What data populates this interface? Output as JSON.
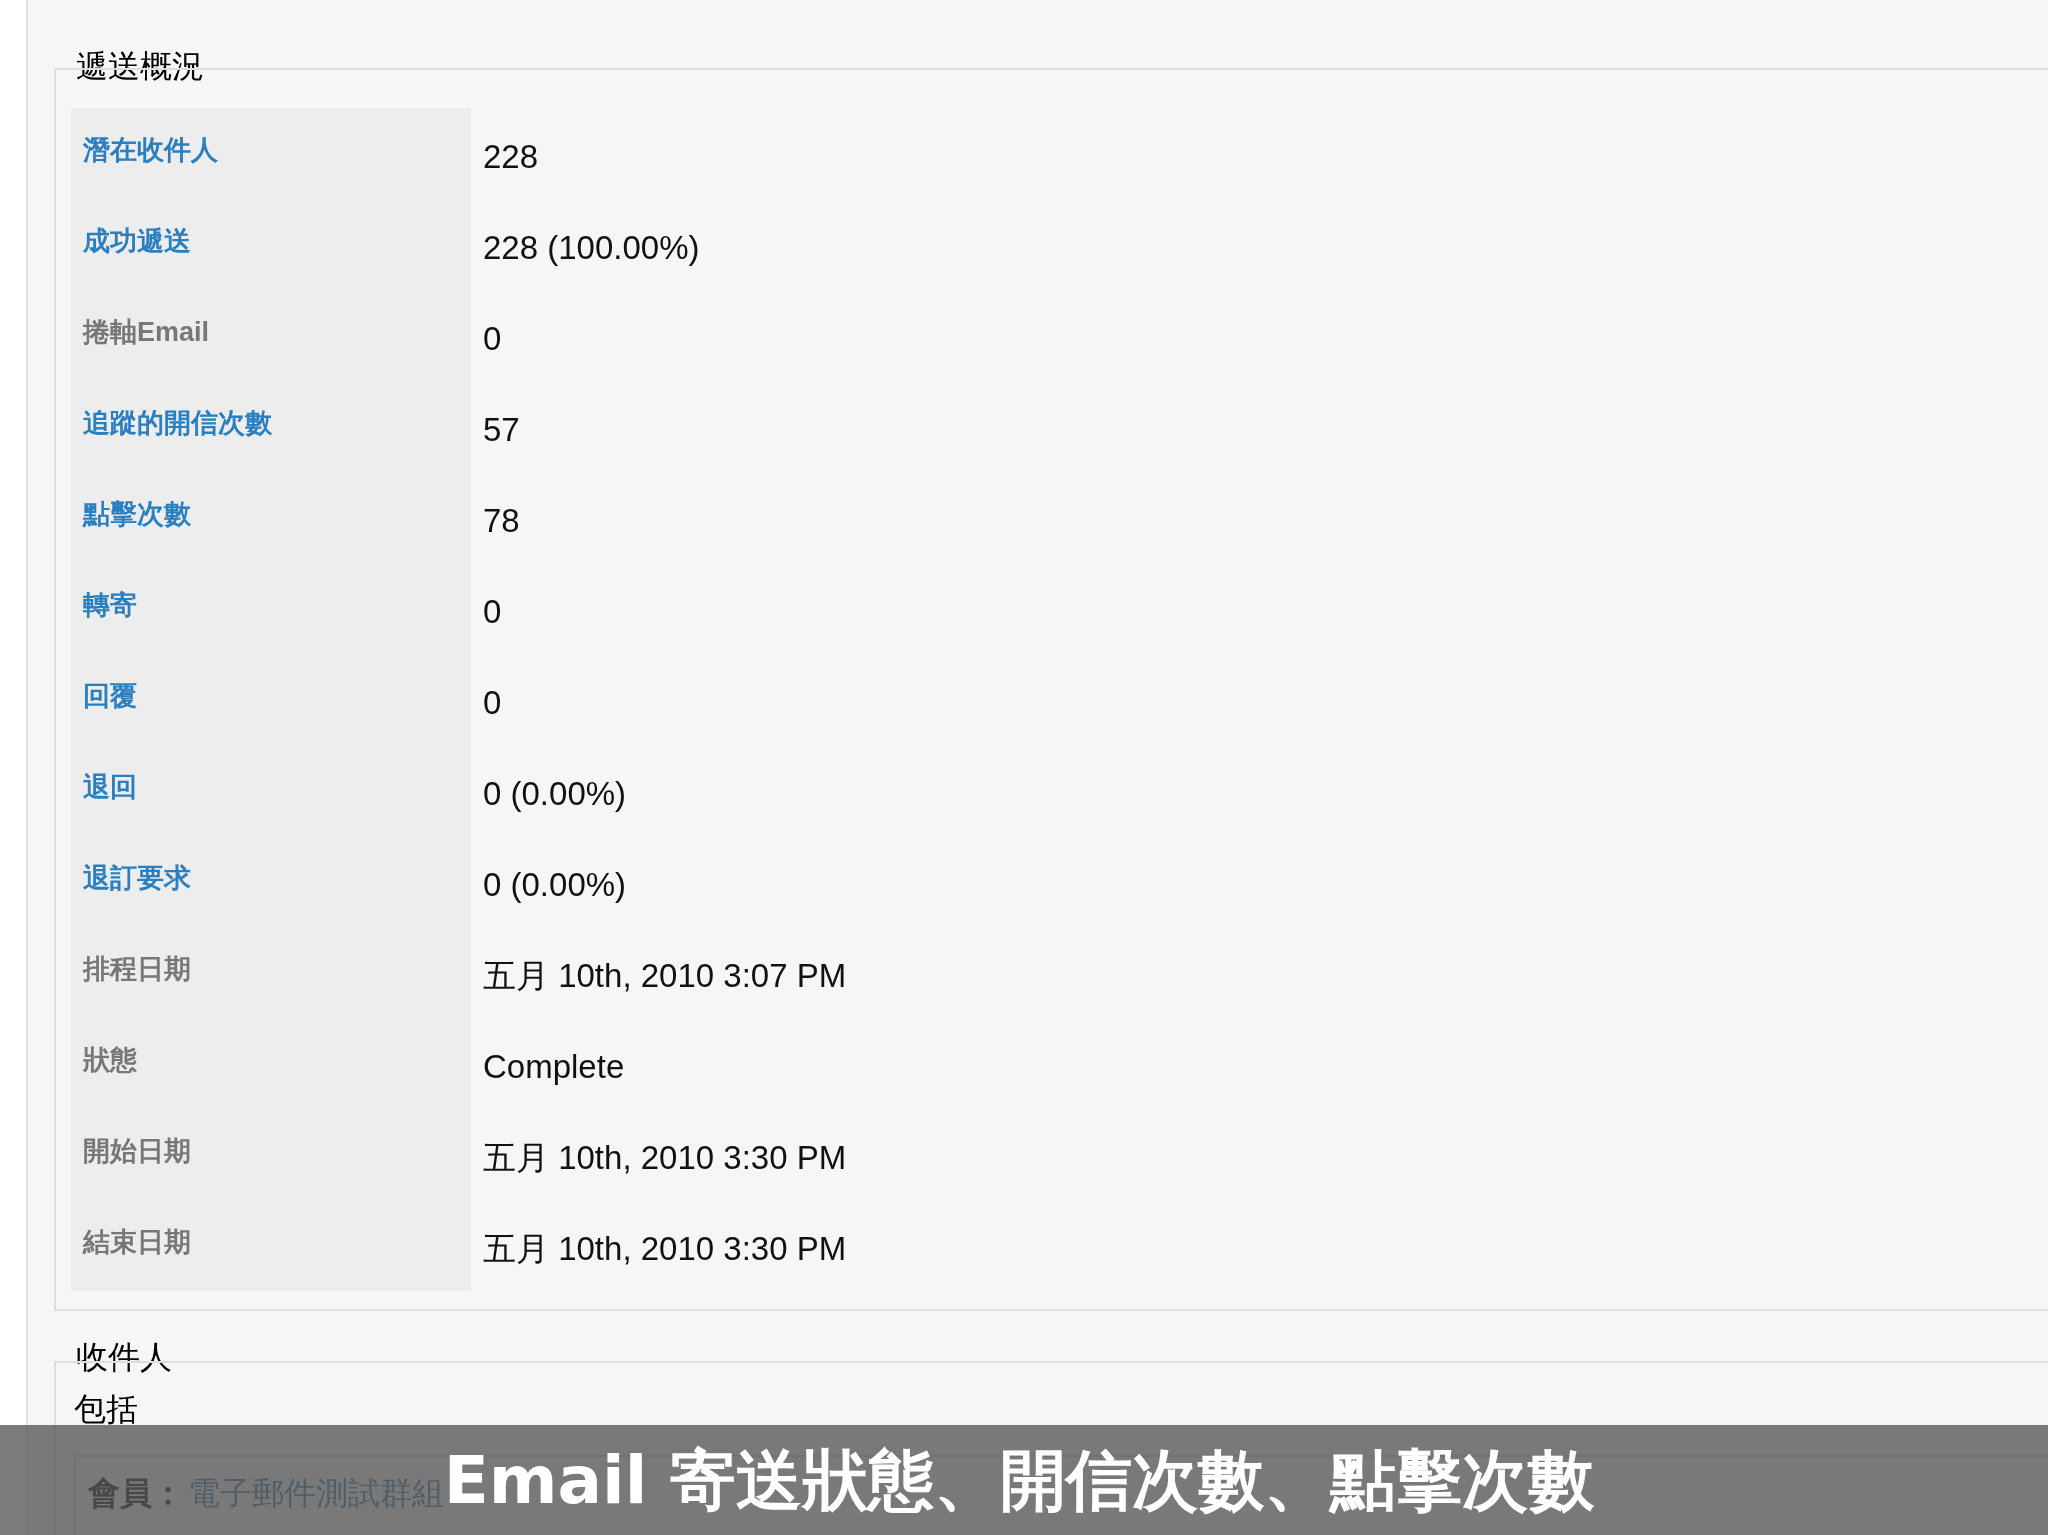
{
  "delivery_summary": {
    "title": "遞送概況",
    "rows": [
      {
        "label": "潛在收件人",
        "kind": "link",
        "value": "228"
      },
      {
        "label": "成功遞送",
        "kind": "link",
        "value": "228 (100.00%)"
      },
      {
        "label": "捲軸Email",
        "kind": "text",
        "value": "0"
      },
      {
        "label": "追蹤的開信次數",
        "kind": "link",
        "value": "57"
      },
      {
        "label": "點擊次數",
        "kind": "link",
        "value": "78"
      },
      {
        "label": "轉寄",
        "kind": "link",
        "value": "0"
      },
      {
        "label": "回覆",
        "kind": "link",
        "value": "0"
      },
      {
        "label": "退回",
        "kind": "link",
        "value": "0 (0.00%)"
      },
      {
        "label": "退訂要求",
        "kind": "link",
        "value": "0 (0.00%)"
      },
      {
        "label": "排程日期",
        "kind": "text",
        "value": "五月 10th, 2010 3:07 PM"
      },
      {
        "label": "狀態",
        "kind": "text",
        "value": "Complete"
      },
      {
        "label": "開始日期",
        "kind": "text",
        "value": "五月 10th, 2010 3:30 PM"
      },
      {
        "label": "結束日期",
        "kind": "text",
        "value": "五月 10th, 2010 3:30 PM"
      }
    ]
  },
  "recipients": {
    "title": "收件人",
    "include_label": "包括",
    "member_label": "會員：",
    "member_group": "電子郵件測試群組"
  },
  "caption": "Email 寄送狀態、開信次數、點擊次數"
}
